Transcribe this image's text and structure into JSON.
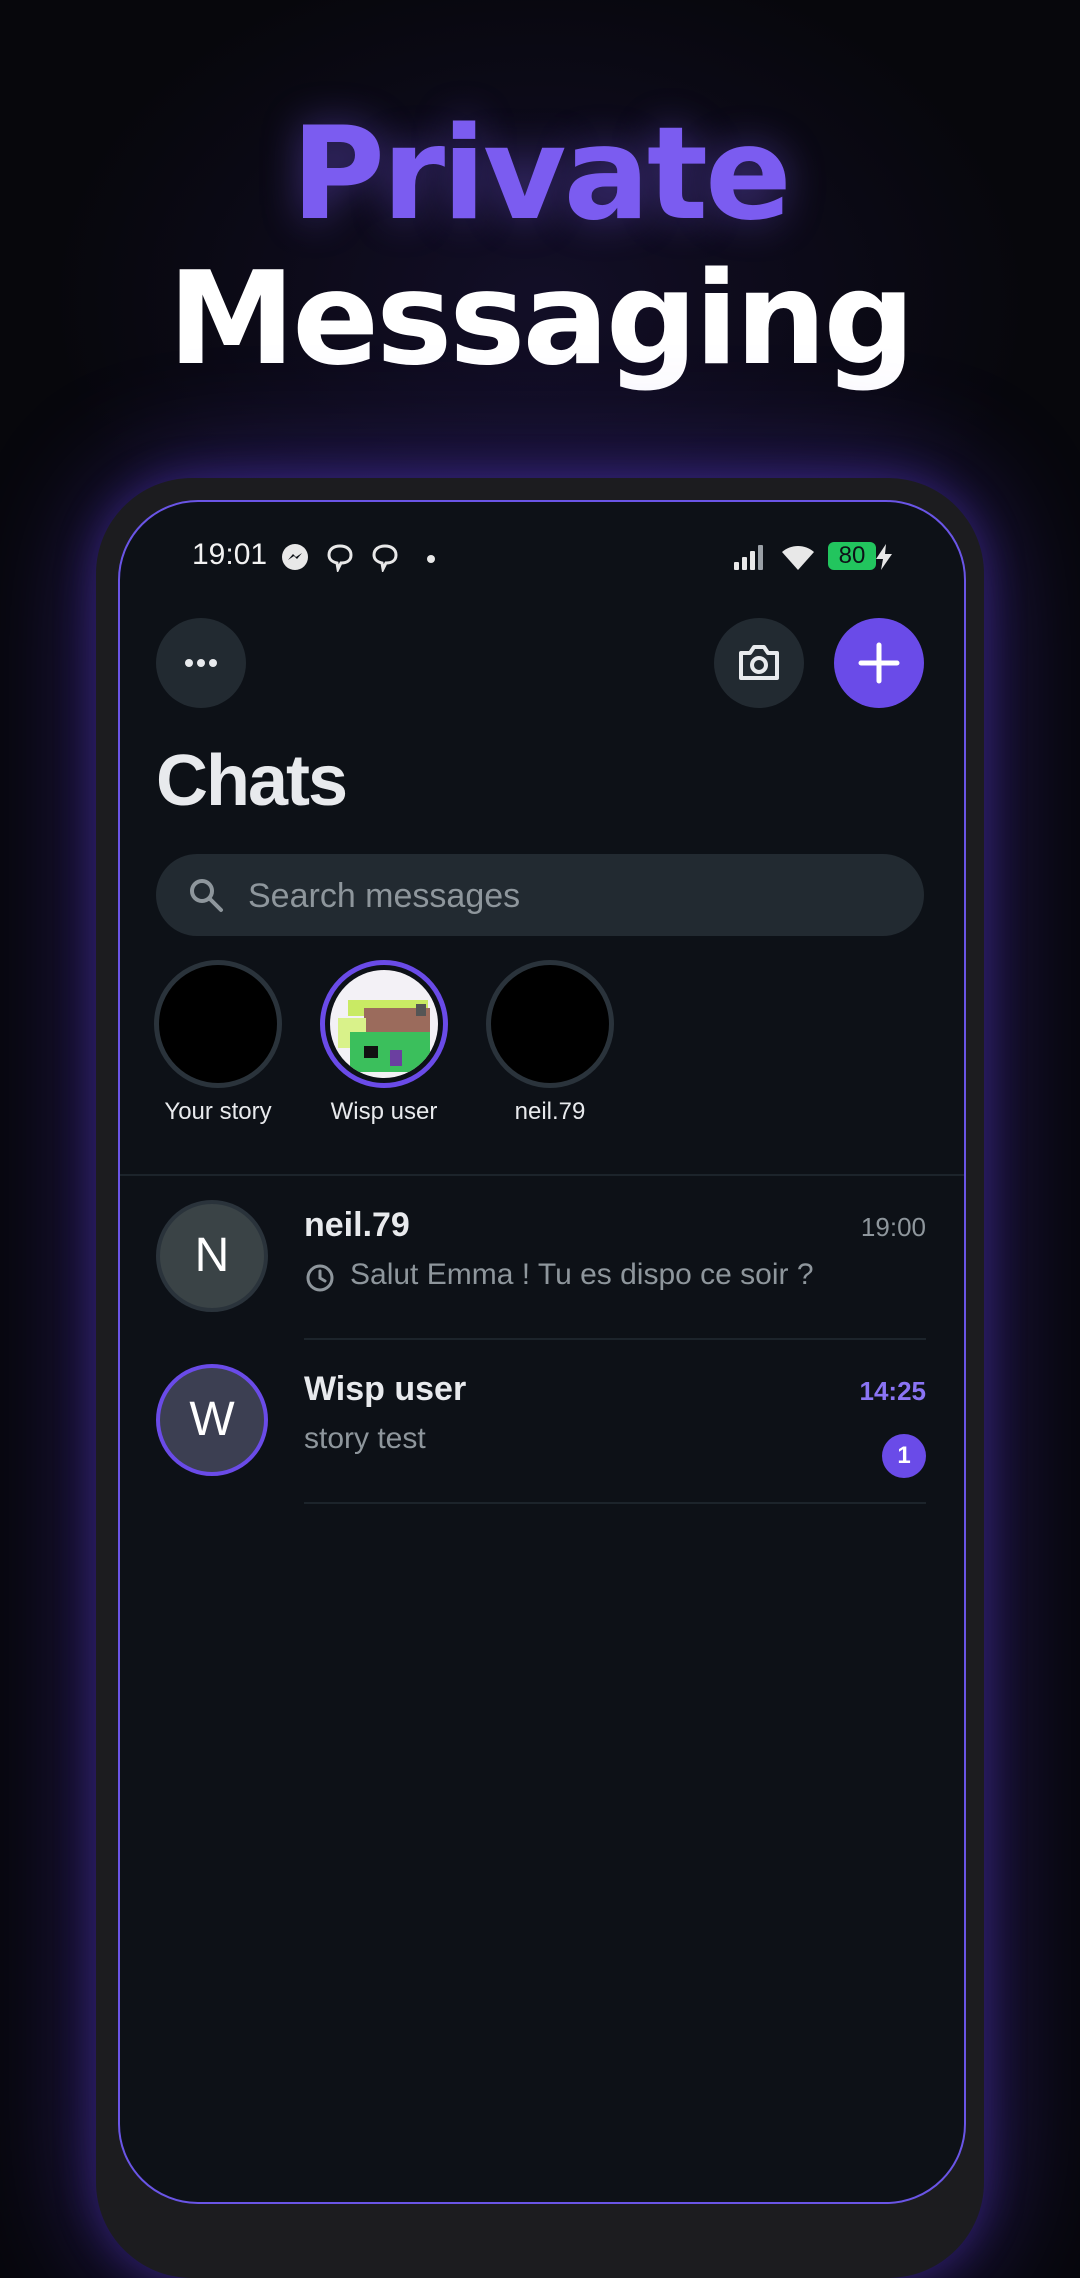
{
  "headline": {
    "line1": "Private",
    "line2": "Messaging"
  },
  "status_bar": {
    "time": "19:01",
    "battery": "80"
  },
  "header": {
    "title": "Chats"
  },
  "search": {
    "placeholder": "Search messages"
  },
  "stories": [
    {
      "label": "Your story"
    },
    {
      "label": "Wisp user"
    },
    {
      "label": "neil.79"
    }
  ],
  "chats": [
    {
      "initial": "N",
      "name": "neil.79",
      "time": "19:00",
      "message": "Salut Emma ! Tu es dispo ce soir ?"
    },
    {
      "initial": "W",
      "name": "Wisp user",
      "time": "14:25",
      "message": "story test",
      "unread": "1"
    }
  ],
  "colors": {
    "accent": "#6a4be8",
    "headline_accent": "#7b5cf0",
    "battery": "#22c55e",
    "background": "#0d1117"
  }
}
